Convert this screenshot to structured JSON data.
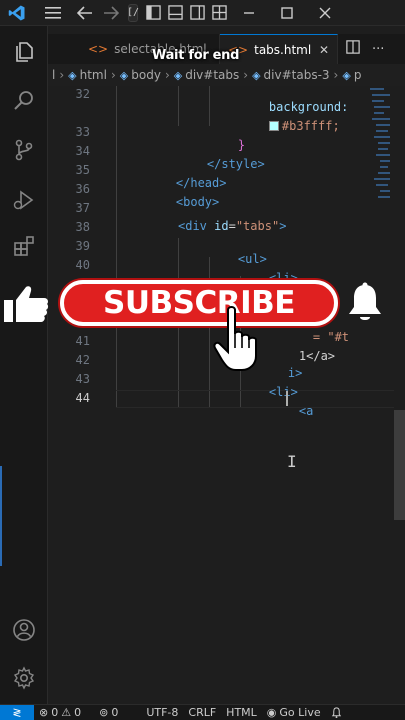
{
  "titlebar": {
    "command_center_text": "[/"
  },
  "tabs": [
    {
      "label": "selectable.html",
      "active": false
    },
    {
      "label": "tabs.html",
      "active": true
    }
  ],
  "breadcrumb": {
    "items": [
      "l",
      "html",
      "body",
      "div#tabs",
      "div#tabs-3",
      "p"
    ]
  },
  "editor": {
    "line_numbers": [
      "32",
      "33",
      "34",
      "35",
      "36",
      "37",
      "38",
      "39",
      "40",
      "41",
      "42",
      "43",
      "44"
    ],
    "current_line": "44",
    "code": {
      "l32_prop": "background:",
      "l32_val": "#b3ffff;",
      "l33_brace": "}",
      "l34_close_style": "</style>",
      "l35_close_head": "</head>",
      "l36_body": "<body>",
      "l38_div_open": "<div",
      "l38_attr": "id",
      "l38_eq": "=",
      "l38_val": "\"tabs\"",
      "l38_gt": ">",
      "l39_ul": "<ul>",
      "l40_li": "<li>",
      "l41_text_a": "1</a>",
      "l41_partial": "= \"#t",
      "l42_li_close": "i>",
      "l43_li": "<li>",
      "l44_a": "<a"
    }
  },
  "overlay": {
    "caption": "Wait for end",
    "subscribe_label": "SUBSCRIBE"
  },
  "statusbar": {
    "errors": "0",
    "warnings": "0",
    "ports": "0",
    "encoding": "UTF-8",
    "eol": "CRLF",
    "language": "HTML",
    "golive": "Go Live"
  },
  "colors": {
    "accent": "#0078d4",
    "subscribe_red": "#e02020",
    "swatch": "#b3ffff"
  }
}
